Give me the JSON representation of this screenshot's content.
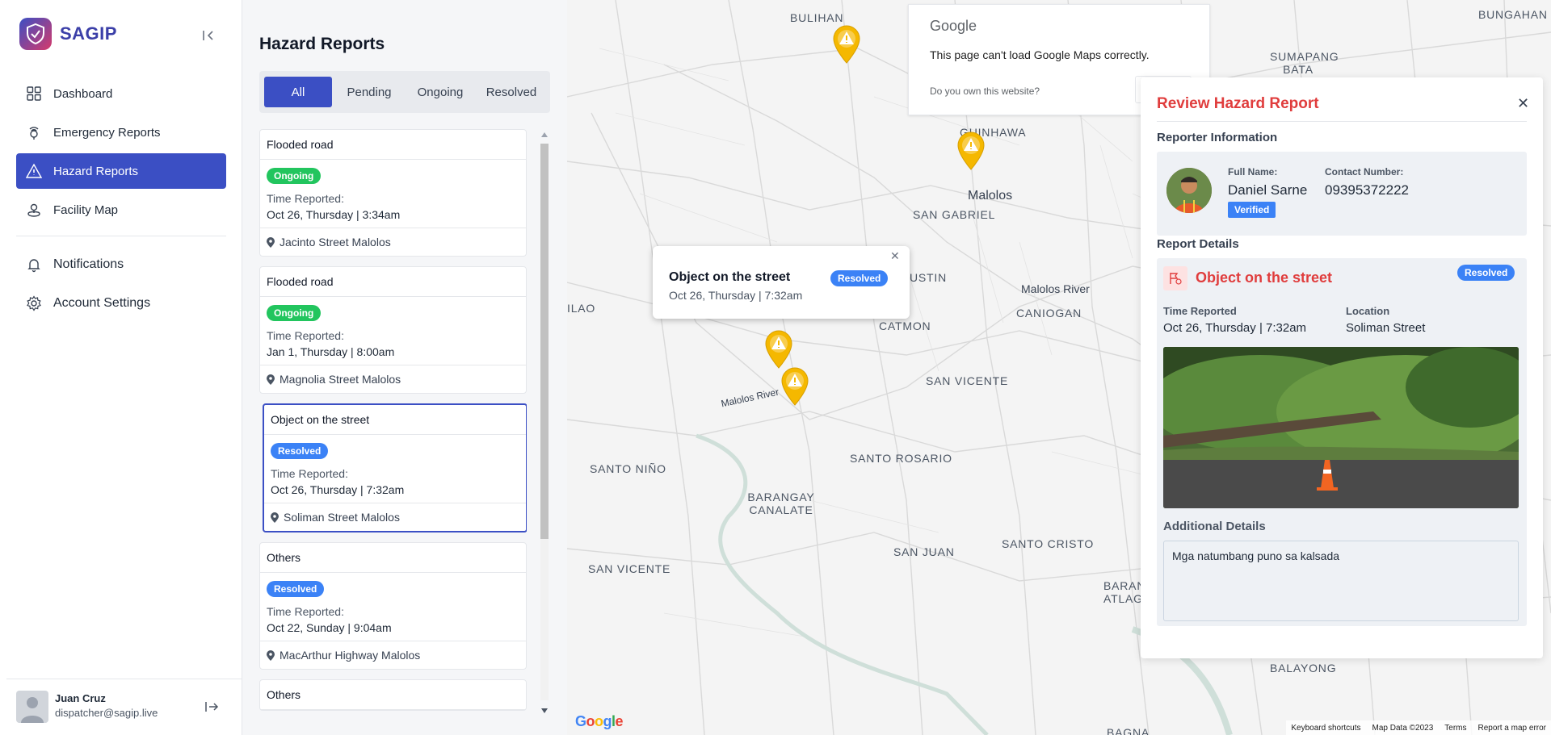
{
  "app": {
    "name": "SAGIP"
  },
  "sidebar": {
    "items": [
      {
        "label": "Dashboard",
        "icon": "dashboard-icon"
      },
      {
        "label": "Emergency Reports",
        "icon": "emergency-icon"
      },
      {
        "label": "Hazard Reports",
        "icon": "hazard-icon",
        "active": true
      },
      {
        "label": "Facility Map",
        "icon": "facility-icon"
      }
    ],
    "secondary": [
      {
        "label": "Notifications",
        "icon": "bell-icon"
      },
      {
        "label": "Account Settings",
        "icon": "gear-icon"
      }
    ],
    "user": {
      "name": "Juan Cruz",
      "email": "dispatcher@sagip.live"
    }
  },
  "reports": {
    "title": "Hazard Reports",
    "tabs": [
      "All",
      "Pending",
      "Ongoing",
      "Resolved"
    ],
    "active_tab": "All",
    "time_label": "Time Reported:",
    "cards": [
      {
        "title": "Flooded road",
        "status": "Ongoing",
        "time": "Oct 26, Thursday | 3:34am",
        "location": "Jacinto Street Malolos"
      },
      {
        "title": "Flooded road",
        "status": "Ongoing",
        "time": "Jan 1, Thursday | 8:00am",
        "location": "Magnolia Street Malolos"
      },
      {
        "title": "Object on the street",
        "status": "Resolved",
        "time": "Oct 26, Thursday | 7:32am",
        "location": "Soliman Street Malolos",
        "selected": true
      },
      {
        "title": "Others",
        "status": "Resolved",
        "time": "Oct 22, Sunday | 9:04am",
        "location": "MacArthur Highway Malolos"
      },
      {
        "title": "Others",
        "status": "",
        "time": "",
        "location": ""
      }
    ]
  },
  "map": {
    "labels": [
      "BULIHAN",
      "BUNGAHAN",
      "SUMAPANG BATA",
      "GUINHAWA",
      "Malolos",
      "SAN GABRIEL",
      "USTIN",
      "Malolos River",
      "CANIOGAN",
      "CATMON",
      "SAN VICENTE",
      "ILAO",
      "SANTO NIÑO",
      "SANTO ROSARIO",
      "BARANGAY CANALATE",
      "SAN JUAN",
      "SANTO CRISTO",
      "SAN VICENTE",
      "BARANGAY ATLAG",
      "BALAYONG",
      "BAGNA",
      "Malolos River"
    ],
    "google_error": {
      "logo": "Google",
      "message": "This page can't load Google Maps correctly.",
      "question": "Do you own this website?"
    },
    "popup": {
      "title": "Object on the street",
      "status": "Resolved",
      "time": "Oct 26, Thursday | 7:32am"
    },
    "footer": [
      "Keyboard shortcuts",
      "Map Data ©2023",
      "Terms",
      "Report a map error"
    ],
    "google_logo": "Google"
  },
  "review": {
    "title": "Review Hazard Report",
    "reporter_heading": "Reporter Information",
    "full_name_label": "Full Name:",
    "full_name": "Daniel Sarne",
    "contact_label": "Contact Number:",
    "contact": "09395372222",
    "verified": "Verified",
    "details_heading": "Report Details",
    "report_title": "Object on the street",
    "report_status": "Resolved",
    "time_label": "Time Reported",
    "time": "Oct 26, Thursday | 7:32am",
    "location_label": "Location",
    "location": "Soliman Street",
    "additional_label": "Additional Details",
    "additional": "Mga natumbang puno sa kalsada"
  },
  "colors": {
    "primary": "#3b4fc4",
    "danger": "#e03d3d",
    "ongoing": "#22c55e",
    "resolved": "#3b82f6",
    "pin": "#f5b800"
  }
}
